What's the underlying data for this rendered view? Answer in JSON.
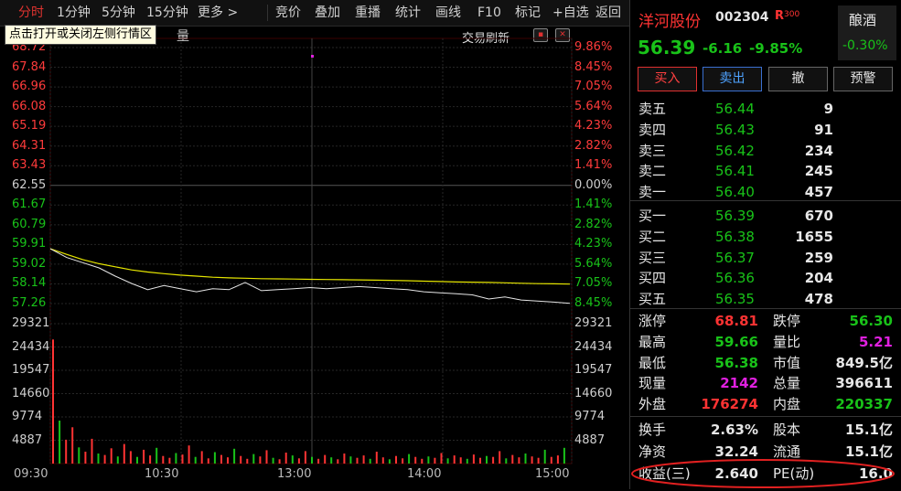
{
  "toolbar": {
    "left_tabs": [
      "分时",
      "1分钟",
      "5分钟",
      "15分钟",
      "更多 >"
    ],
    "right_buttons": [
      "竞价",
      "叠加",
      "重播",
      "统计",
      "画线",
      "F10",
      "标记",
      "+自选",
      "返回"
    ]
  },
  "tooltip": "点击打开或关闭左侧行情区",
  "volume_word": "量",
  "trade_refresh": "交易刷新",
  "chart_data": {
    "type": "line",
    "series": [
      {
        "values": [
          59.02,
          58.6,
          58.35,
          58.1,
          57.7,
          57.35,
          57.05,
          57.25,
          57.1,
          56.95,
          57.1,
          57.05,
          57.4,
          57.0,
          57.05,
          57.1,
          57.15,
          57.1,
          57.15,
          57.2,
          57.15,
          57.1,
          57.05,
          56.95,
          56.9,
          56.85,
          56.8,
          56.6,
          56.7,
          56.55,
          56.5,
          56.45,
          56.39
        ]
      },
      {
        "values": [
          59.02,
          58.75,
          58.5,
          58.3,
          58.15,
          58.0,
          57.9,
          57.82,
          57.75,
          57.7,
          57.65,
          57.62,
          57.6,
          57.58,
          57.57,
          57.56,
          57.55,
          57.54,
          57.53,
          57.52,
          57.51,
          57.5,
          57.48,
          57.46,
          57.44,
          57.42,
          57.41,
          57.4,
          57.38,
          57.36,
          57.34,
          57.33,
          57.32
        ]
      }
    ],
    "price_ticks": [
      "68.72",
      "67.84",
      "66.96",
      "66.08",
      "65.19",
      "64.31",
      "63.43",
      "62.55",
      "61.67",
      "60.79",
      "59.91",
      "59.02",
      "58.14",
      "57.26"
    ],
    "percent_ticks": [
      "9.86%",
      "8.45%",
      "7.05%",
      "5.64%",
      "4.23%",
      "2.82%",
      "1.41%",
      "0.00%",
      "1.41%",
      "2.82%",
      "4.23%",
      "5.64%",
      "7.05%",
      "8.45%"
    ],
    "volume_ticks": [
      "29321",
      "24434",
      "19547",
      "14660",
      "9774",
      "4887"
    ],
    "time_ticks": [
      "09:30",
      "10:30",
      "13:00",
      "14:00",
      "15:00"
    ],
    "ylim": [
      56.38,
      68.72
    ],
    "volume_max": 29321,
    "volumes": [
      26000,
      9000,
      5000,
      7600,
      3400,
      2500,
      5200,
      2100,
      1800,
      3200,
      1500,
      4100,
      2600,
      1400,
      2900,
      1700,
      3300,
      1600,
      1200,
      2200,
      1900,
      3800,
      1400,
      2600,
      1100,
      2400,
      1800,
      1300,
      3100,
      1600,
      1000,
      2000,
      1500,
      2800,
      1200,
      900,
      2300,
      1700,
      1100,
      2600,
      1400,
      1000,
      1800,
      1300,
      900,
      2100,
      1500,
      1200,
      1700,
      1000,
      2500,
      1300,
      900,
      1600,
      1100,
      2000,
      1400,
      1000,
      1500,
      1200,
      2200,
      1100,
      1700,
      1300,
      1000,
      1900,
      1200,
      1600,
      1400,
      2600,
      1100,
      1800,
      1300,
      2100,
      1500,
      1200,
      2900,
      1400,
      1700,
      3300
    ]
  },
  "stock": {
    "name": "洋河股份",
    "code": "002304",
    "tag": "R",
    "tag_sub": "300",
    "price": "56.39",
    "change": "-6.16",
    "change_pct": "-9.85%",
    "sector": "酿酒",
    "sector_pct": "-0.30%"
  },
  "actions": [
    "买入",
    "卖出",
    "撤",
    "预警"
  ],
  "order_book": {
    "sells": [
      {
        "label": "卖五",
        "price": "56.44",
        "vol": "9"
      },
      {
        "label": "卖四",
        "price": "56.43",
        "vol": "91"
      },
      {
        "label": "卖三",
        "price": "56.42",
        "vol": "234"
      },
      {
        "label": "卖二",
        "price": "56.41",
        "vol": "245"
      },
      {
        "label": "卖一",
        "price": "56.40",
        "vol": "457"
      }
    ],
    "buys": [
      {
        "label": "买一",
        "price": "56.39",
        "vol": "670"
      },
      {
        "label": "买二",
        "price": "56.38",
        "vol": "1655"
      },
      {
        "label": "买三",
        "price": "56.37",
        "vol": "259"
      },
      {
        "label": "买四",
        "price": "56.36",
        "vol": "204"
      },
      {
        "label": "买五",
        "price": "56.35",
        "vol": "478"
      }
    ]
  },
  "stats": [
    {
      "l1": "涨停",
      "v1": "68.81",
      "l2": "跌停",
      "v2": "56.30"
    },
    {
      "l1": "最高",
      "v1": "59.66",
      "l2": "量比",
      "v2": "5.21"
    },
    {
      "l1": "最低",
      "v1": "56.38",
      "l2": "市值",
      "v2": "849.5亿"
    },
    {
      "l1": "现量",
      "v1": "2142",
      "l2": "总量",
      "v2": "396611"
    },
    {
      "l1": "外盘",
      "v1": "176274",
      "l2": "内盘",
      "v2": "220337"
    }
  ],
  "stats2": [
    {
      "l1": "换手",
      "v1": "2.63%",
      "l2": "股本",
      "v2": "15.1亿"
    },
    {
      "l1": "净资",
      "v1": "32.24",
      "l2": "流通",
      "v2": "15.1亿"
    },
    {
      "l1": "收益(三)",
      "v1": "2.640",
      "l2": "PE(动)",
      "v2": "16.0"
    }
  ],
  "colors": {
    "up": "#ff3333",
    "down": "#19c219",
    "price_line": "#e6e6e6",
    "avg_line": "#e6e600",
    "highlight": "#e02020"
  }
}
